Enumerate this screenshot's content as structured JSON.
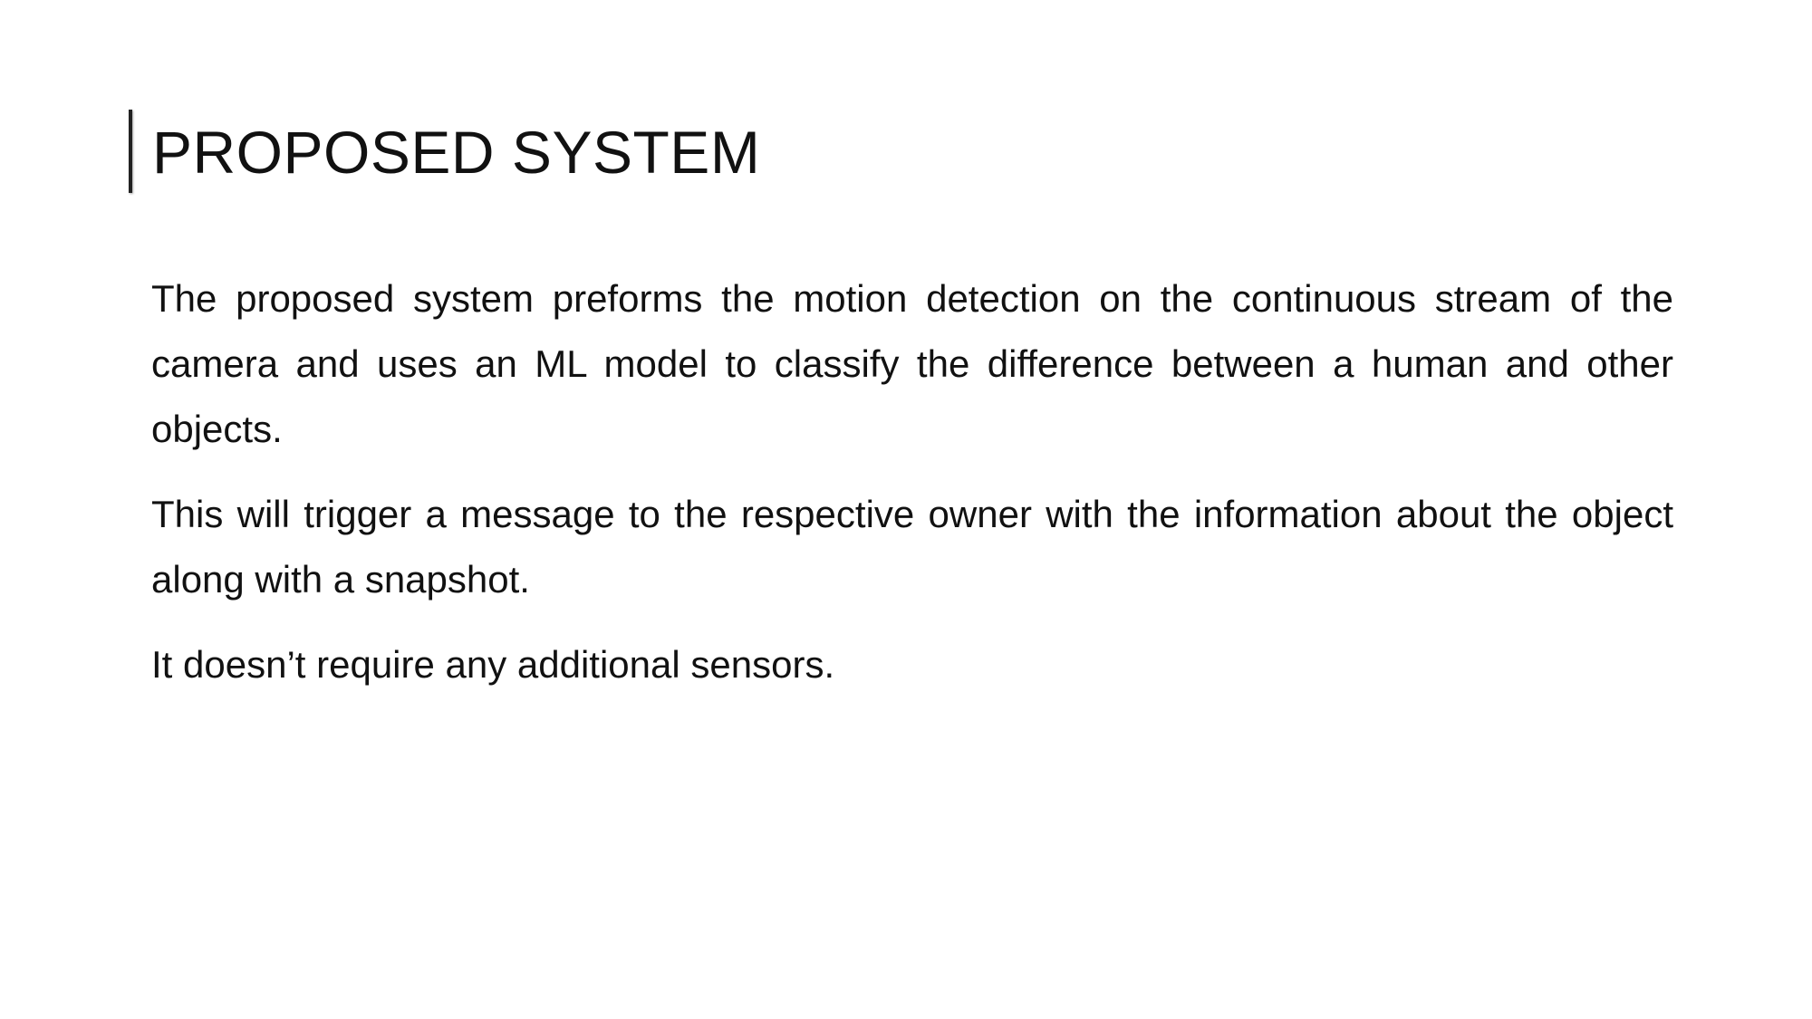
{
  "slide": {
    "title": "PROPOSED SYSTEM",
    "paragraphs": [
      "The proposed system preforms the motion detection on the continuous stream of the camera and uses an ML model to classify the difference between a human and other objects.",
      "This will trigger a message to the respective owner with the information about the object along with a snapshot.",
      "It doesn’t require any additional sensors."
    ]
  }
}
